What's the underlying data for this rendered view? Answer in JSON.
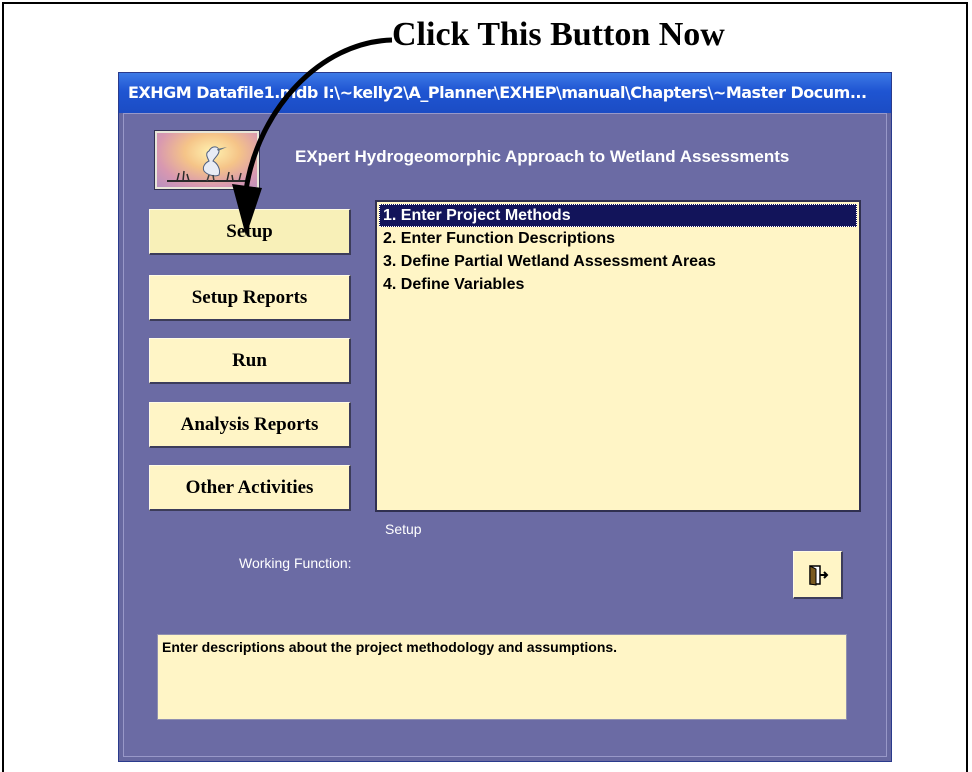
{
  "callout": {
    "text": "Click This Button Now"
  },
  "window": {
    "title": "EXHGM   Datafile1.mdb   I:\\~kelly2\\A_Planner\\EXHEP\\manual\\Chapters\\~Master Docum..."
  },
  "app": {
    "heading": "EXpert Hydrogeomorphic Approach to Wetland Assessments"
  },
  "nav_buttons": [
    {
      "label": "Setup"
    },
    {
      "label": "Setup Reports"
    },
    {
      "label": "Run"
    },
    {
      "label": "Analysis Reports"
    },
    {
      "label": "Other Activities"
    }
  ],
  "task_list": {
    "items": [
      {
        "label": "1. Enter Project Methods",
        "selected": true
      },
      {
        "label": "2. Enter Function Descriptions"
      },
      {
        "label": "3. Define Partial Wetland Assessment Areas"
      },
      {
        "label": "4. Define Variables"
      }
    ],
    "caption": "Setup"
  },
  "working_function_label": "Working Function:",
  "description": "Enter descriptions about the project methodology and assumptions.",
  "colors": {
    "panel": "#6b6ba4",
    "button": "#fff5c6",
    "selection": "#12145a",
    "titlebar": "#1f55d2"
  },
  "icons": {
    "exit": "exit-door-icon",
    "logo": "heron-logo"
  }
}
